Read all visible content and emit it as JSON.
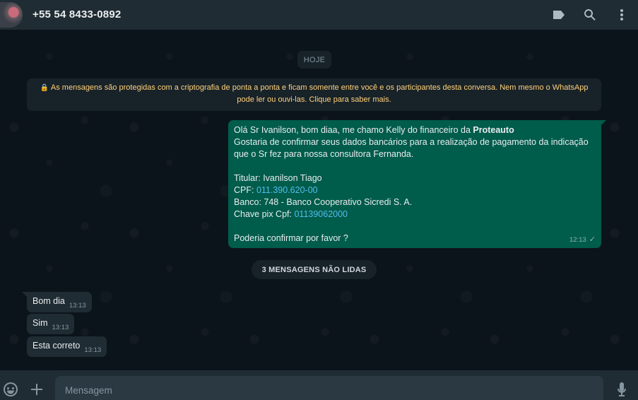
{
  "header": {
    "contact_name": "+55 54 8433-0892",
    "icons": [
      "label-icon",
      "search-icon",
      "menu-icon"
    ]
  },
  "chat": {
    "date_chip": "HOJE",
    "encryption_notice": {
      "line1": "As mensagens são protegidas com a criptografia de ponta a ponta e ficam somente entre você e os participantes desta conversa. Nem mesmo o WhatsApp",
      "line2": "pode ler ou ouvi-las. Clique para saber mais."
    },
    "outgoing_message": {
      "greeting": "Olá Sr Ivanilson, bom diaa, me chamo Kelly do financeiro da ",
      "company": "Proteauto",
      "line2": "Gostaria de confirmar seus dados bancários para a realização de pagamento da indicação",
      "line3": "que o Sr fez para nossa consultora Fernanda.",
      "titular": "Titular: Ivanilson Tiago",
      "cpf_label": "CPF: ",
      "cpf_value": "011.390.620-00",
      "banco": "Banco: 748 - Banco Cooperativo Sicredi S. A.",
      "pix_label": "Chave pix Cpf: ",
      "pix_value": "01139062000",
      "closing": "Poderia confirmar por favor ?",
      "time": "12:13",
      "status_icon": "single-check-icon"
    },
    "unread_chip": "3 MENSAGENS NÃO LIDAS",
    "incoming_messages": [
      {
        "text": "Bom dia",
        "time": "13:13"
      },
      {
        "text": "Sim",
        "time": "13:13"
      },
      {
        "text": "Esta correto",
        "time": "13:13"
      }
    ]
  },
  "footer": {
    "placeholder": "Mensagem",
    "icons": [
      "emoji-icon",
      "plus-icon",
      "microphone-icon"
    ]
  },
  "colors": {
    "outgoing_bubble": "#005c4b",
    "incoming_bubble": "#202c33",
    "notice_text": "#ffd279",
    "link": "#53bdeb"
  }
}
